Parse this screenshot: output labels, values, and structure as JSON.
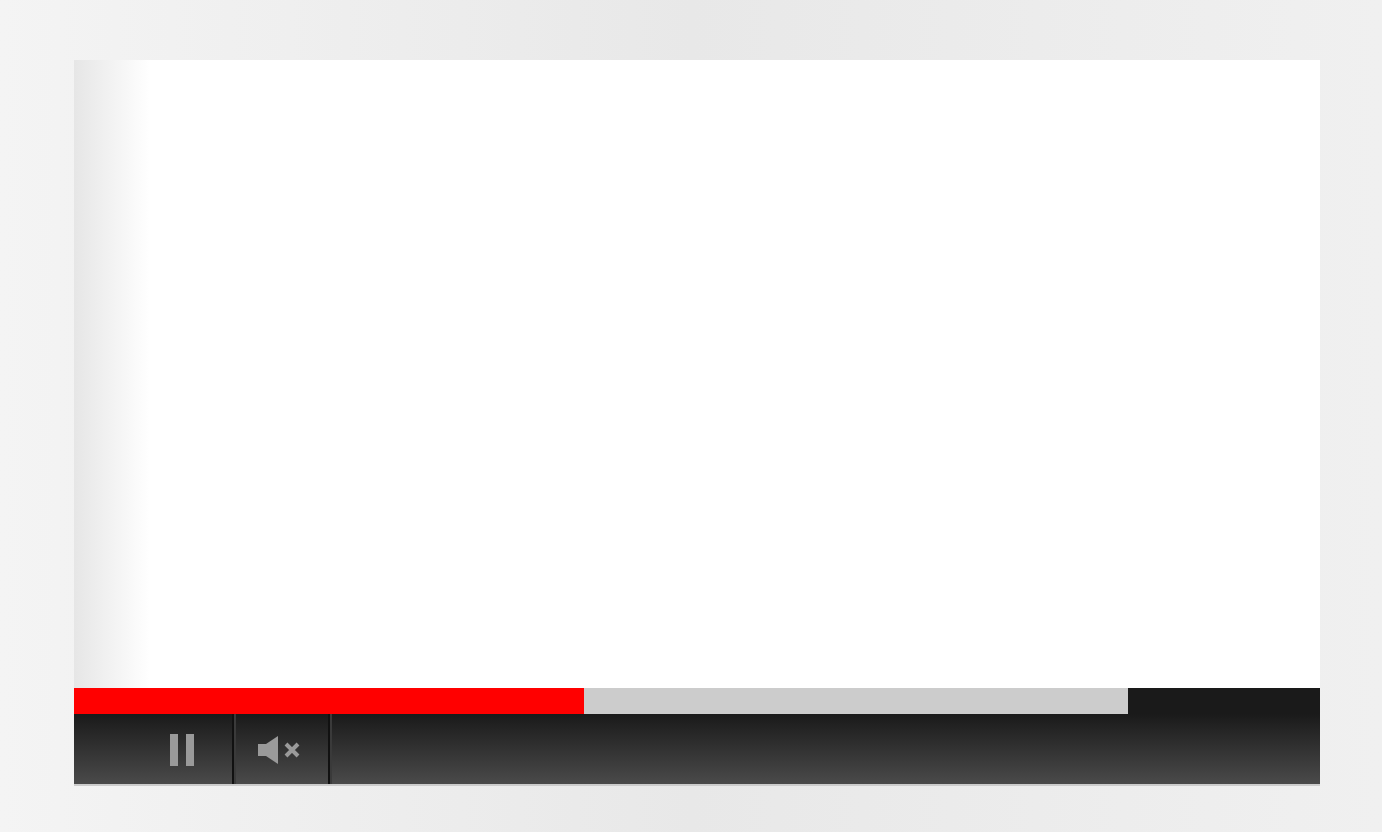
{
  "player": {
    "playing": true,
    "muted": true,
    "progress": {
      "level": 0.41
    },
    "buffered": {
      "level": 0.846
    }
  }
}
